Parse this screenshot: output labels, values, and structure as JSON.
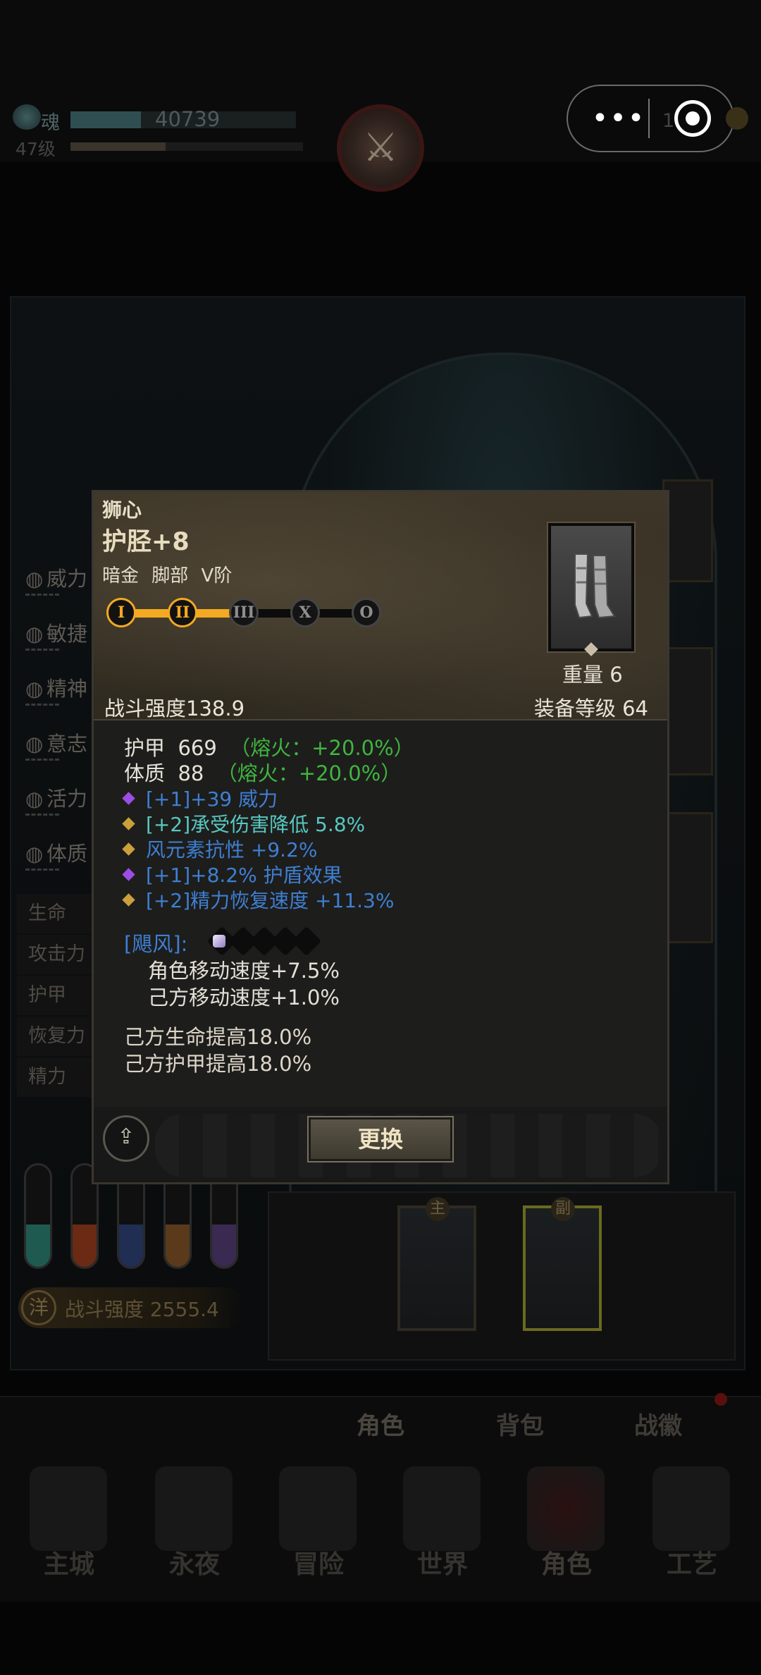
{
  "hud": {
    "soul_label": "魂",
    "soul_value": "40739",
    "level": "47级",
    "menu_dots": "•••",
    "peek_digit": "1"
  },
  "side_stats": [
    "威力",
    "敏捷",
    "精神",
    "意志",
    "活力",
    "体质"
  ],
  "attributes": [
    "生命",
    "攻击力",
    "护甲",
    "恢复力",
    "精力"
  ],
  "vial_colors": [
    "#1f5a50",
    "#6a2a14",
    "#1f2e52",
    "#5a3a1a",
    "#3a2a52"
  ],
  "power": {
    "label": "战斗强度 2555.4",
    "icon": "洋"
  },
  "weapon_tags": [
    "主",
    "副"
  ],
  "bottom_tabs": [
    "角色",
    "背包",
    "战徽"
  ],
  "nav": [
    "主城",
    "永夜",
    "冒险",
    "世界",
    "角色",
    "工艺"
  ],
  "item": {
    "set_name": "狮心",
    "name": "护胫+8",
    "tags": "暗金 脚部 V阶",
    "tiers": [
      "I",
      "II",
      "III",
      "X",
      "O"
    ],
    "tiers_unlocked": 2,
    "weight": "重量 6",
    "combat_power": "战斗强度138.9",
    "equip_level": "装备等级 64",
    "main_stats": [
      {
        "label": "护甲",
        "value": "669",
        "bonus": "（熔火：+20.0%）"
      },
      {
        "label": "体质",
        "value": "88",
        "bonus": "（熔火：+20.0%）"
      }
    ],
    "affixes": [
      {
        "text": "[+1]+39 威力",
        "gem": "purple",
        "tone": "blue"
      },
      {
        "text": "[+2]承受伤害降低 5.8%",
        "gem": "gold",
        "tone": "cyan"
      },
      {
        "text": "风元素抗性 +9.2%",
        "gem": "gold",
        "tone": "blue"
      },
      {
        "text": "[+1]+8.2% 护盾效果",
        "gem": "purple",
        "tone": "blue"
      },
      {
        "text": "[+2]精力恢复速度 +11.3%",
        "gem": "gold",
        "tone": "blue"
      }
    ],
    "set_bonus_title": "[飓风]:",
    "set_bonus_owned": 1,
    "set_bonus_total": 5,
    "set_effects": [
      "角色移动速度+7.5%",
      "己方移动速度+1.0%"
    ],
    "conditional_effects": [
      "己方生命提高18.0%",
      "己方护甲提高18.0%"
    ],
    "replace_label": "更换",
    "share_icon": "share-icon"
  }
}
